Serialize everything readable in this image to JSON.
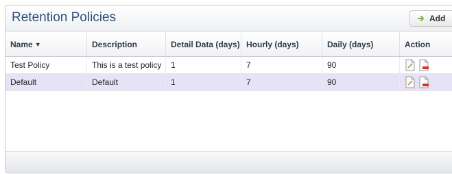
{
  "panel": {
    "title": "Retention Policies",
    "add_label": "Add"
  },
  "table": {
    "columns": [
      {
        "label": "Name",
        "sort": "desc"
      },
      {
        "label": "Description"
      },
      {
        "label": "Detail Data (days)"
      },
      {
        "label": "Hourly (days)"
      },
      {
        "label": "Daily (days)"
      },
      {
        "label": "Action"
      }
    ],
    "rows": [
      {
        "name": "Test Policy",
        "description": "This is a test policy",
        "detail": "1",
        "hourly": "7",
        "daily": "90",
        "selected": false
      },
      {
        "name": "Default",
        "description": "Default",
        "detail": "1",
        "hourly": "7",
        "daily": "90",
        "selected": true
      }
    ],
    "actions": [
      "edit-icon",
      "delete-icon"
    ]
  },
  "colors": {
    "title": "#2b4f7a",
    "selected_row": "#e6e3f6",
    "add_icon": "#7db04a"
  }
}
